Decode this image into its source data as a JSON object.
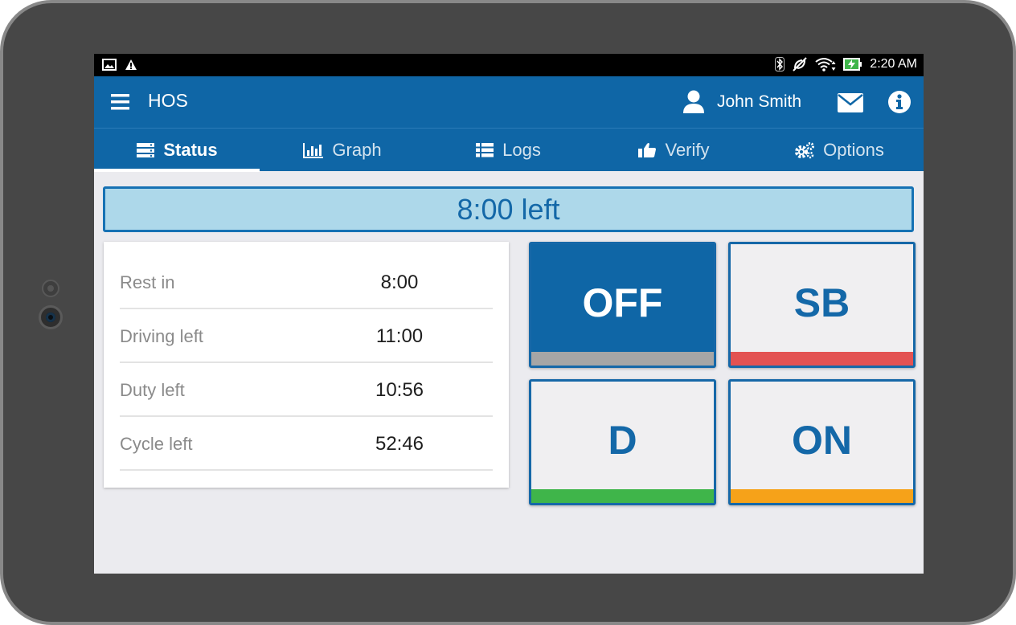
{
  "status_bar": {
    "time": "2:20 AM",
    "left_icons": [
      "image-icon",
      "warning-icon"
    ],
    "right_icons": [
      "bluetooth-icon",
      "no-sync-icon",
      "wifi-icon",
      "battery-charging-icon"
    ]
  },
  "app_bar": {
    "title": "HOS",
    "user_name": "John Smith",
    "icons": [
      "menu-icon",
      "user-icon",
      "mail-icon",
      "info-icon"
    ]
  },
  "tabs": [
    {
      "label": "Status",
      "icon": "status-icon",
      "active": true
    },
    {
      "label": "Graph",
      "icon": "bar-chart-icon",
      "active": false
    },
    {
      "label": "Logs",
      "icon": "list-icon",
      "active": false
    },
    {
      "label": "Verify",
      "icon": "thumbs-up-icon",
      "active": false
    },
    {
      "label": "Options",
      "icon": "gears-icon",
      "active": false
    }
  ],
  "banner": {
    "text": "8:00 left"
  },
  "stats": [
    {
      "label": "Rest in",
      "value": "8:00"
    },
    {
      "label": "Driving left",
      "value": "11:00"
    },
    {
      "label": "Duty left",
      "value": "10:56"
    },
    {
      "label": "Cycle left",
      "value": "52:46"
    }
  ],
  "duty_buttons": [
    {
      "label": "OFF",
      "active": true,
      "bar_color": "#a6a6a6"
    },
    {
      "label": "SB",
      "active": false,
      "bar_color": "#e35252"
    },
    {
      "label": "D",
      "active": false,
      "bar_color": "#3fb54a"
    },
    {
      "label": "ON",
      "active": false,
      "bar_color": "#f6a219"
    }
  ],
  "colors": {
    "primary": "#0f66a6",
    "banner_bg": "#add8ea",
    "screen_bg": "#ebebef"
  }
}
